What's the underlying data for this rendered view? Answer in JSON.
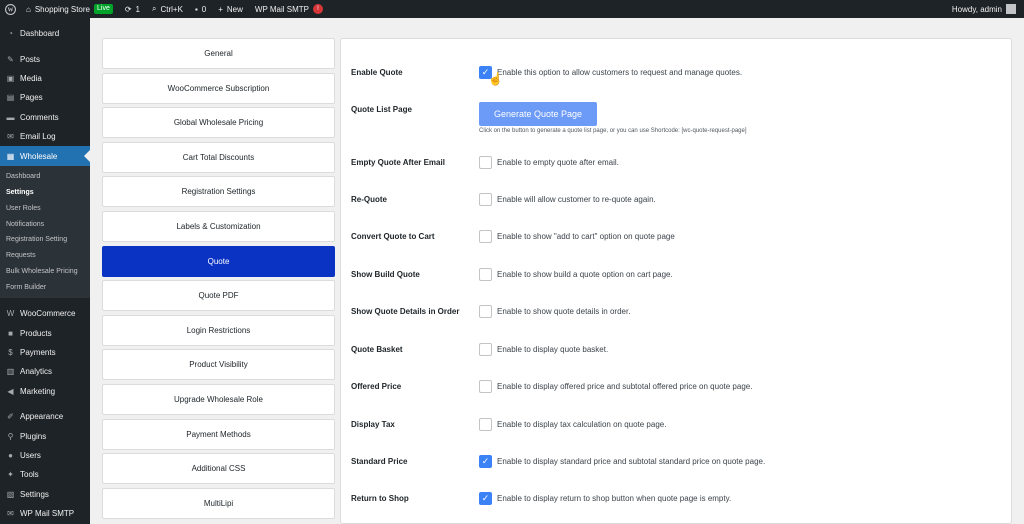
{
  "adminbar": {
    "site_name": "Shopping Store",
    "live_badge": "Live",
    "updates_count": "1",
    "search_shortcut": "Ctrl+K",
    "comments_count": "0",
    "new_label": "New",
    "smtp_label": "WP Mail SMTP",
    "smtp_badge": "!",
    "greeting": "Howdy, admin"
  },
  "sidebar": {
    "items_top": [
      {
        "label": "Dashboard",
        "icon": "dashboard-icon"
      },
      {
        "label": "Posts",
        "icon": "pin-icon"
      },
      {
        "label": "Media",
        "icon": "media-icon"
      },
      {
        "label": "Pages",
        "icon": "page-icon"
      },
      {
        "label": "Comments",
        "icon": "comment-icon"
      },
      {
        "label": "Email Log",
        "icon": "email-icon"
      },
      {
        "label": "Wholesale",
        "icon": "store-icon"
      }
    ],
    "submenu": [
      "Dashboard",
      "Settings",
      "User Roles",
      "Notifications",
      "Registration Setting",
      "Requests",
      "Bulk Wholesale Pricing",
      "Form Builder"
    ],
    "items_bottom": [
      {
        "label": "WooCommerce"
      },
      {
        "label": "Products"
      },
      {
        "label": "Payments"
      },
      {
        "label": "Analytics"
      },
      {
        "label": "Marketing"
      },
      {
        "label": "Appearance"
      },
      {
        "label": "Plugins"
      },
      {
        "label": "Users"
      },
      {
        "label": "Tools"
      },
      {
        "label": "Settings"
      },
      {
        "label": "WP Mail SMTP"
      }
    ]
  },
  "tabs": [
    "General",
    "WooCommerce Subscription",
    "Global Wholesale Pricing",
    "Cart Total Discounts",
    "Registration Settings",
    "Labels & Customization",
    "Quote",
    "Quote PDF",
    "Login Restrictions",
    "Product Visibility",
    "Upgrade Wholesale Role",
    "Payment Methods",
    "Additional CSS",
    "MultiLipi"
  ],
  "active_tab": "Quote",
  "settings": {
    "enable_quote": {
      "label": "Enable Quote",
      "desc": "Enable this option to allow customers to request and manage quotes.",
      "checked": true
    },
    "quote_list_page": {
      "label": "Quote List Page",
      "button": "Generate Quote Page",
      "hint": "Click on the button to generate a quote list page, or you can use Shortcode: [wc-quote-request-page]"
    },
    "empty_quote": {
      "label": "Empty Quote After Email",
      "desc": "Enable to empty quote after email.",
      "checked": false
    },
    "re_quote": {
      "label": "Re-Quote",
      "desc": "Enable will allow customer to re-quote again.",
      "checked": false
    },
    "convert_quote": {
      "label": "Convert Quote to Cart",
      "desc": "Enable to show \"add to cart\" option on quote page",
      "checked": false
    },
    "show_build_quote": {
      "label": "Show Build Quote",
      "desc": "Enable to show build a quote option on cart page.",
      "checked": false
    },
    "show_details": {
      "label": "Show Quote Details in Order",
      "desc": "Enable to show quote details in order.",
      "checked": false
    },
    "quote_basket": {
      "label": "Quote Basket",
      "desc": "Enable to display quote basket.",
      "checked": false
    },
    "offered_price": {
      "label": "Offered Price",
      "desc": "Enable to display offered price and subtotal offered price on quote page.",
      "checked": false
    },
    "display_tax": {
      "label": "Display Tax",
      "desc": "Enable to display tax calculation on quote page.",
      "checked": false
    },
    "standard_price": {
      "label": "Standard Price",
      "desc": "Enable to display standard price and subtotal standard price on quote page.",
      "checked": true
    },
    "return_to_shop": {
      "label": "Return to Shop",
      "desc": "Enable to display return to shop button when quote page is empty.",
      "checked": true
    }
  }
}
